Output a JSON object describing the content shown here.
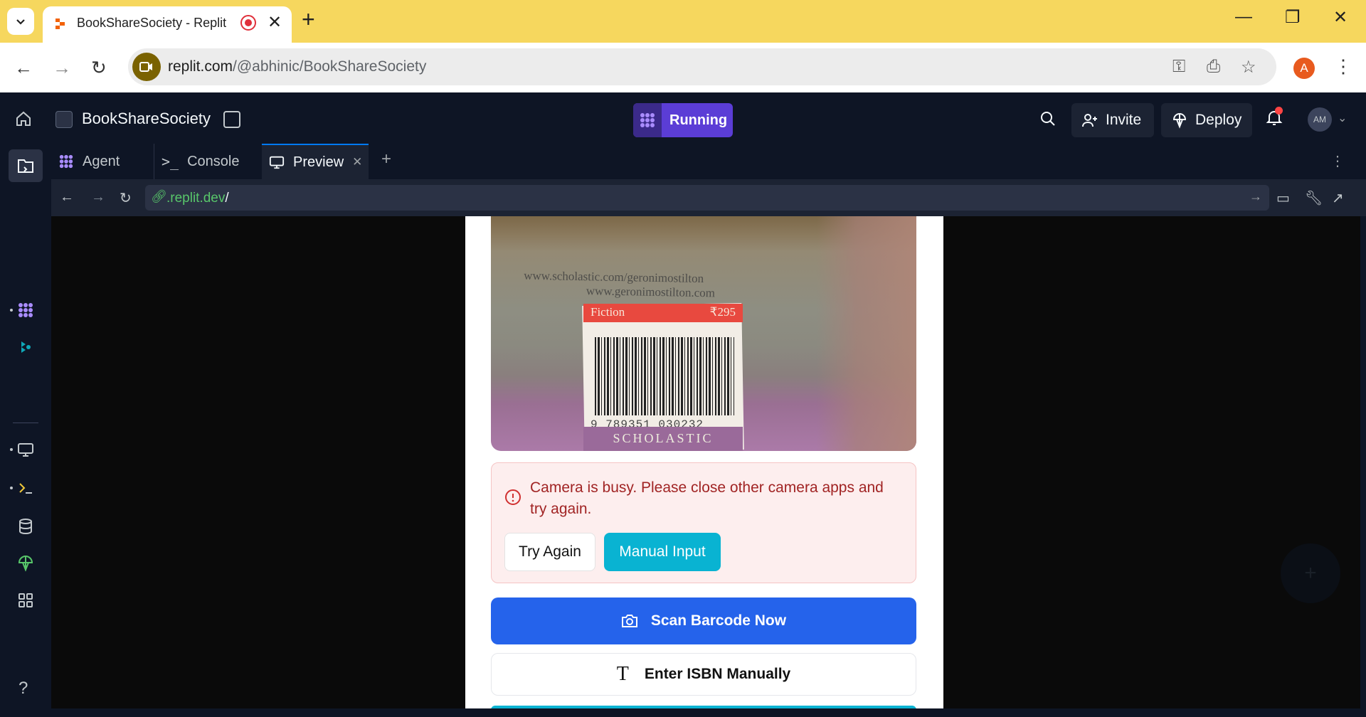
{
  "browser": {
    "tab_title": "BookShareSociety - Replit",
    "url_host": "replit.com",
    "url_path": "/@abhinic/BookShareSociety",
    "profile_initial": "A"
  },
  "app": {
    "repl_name": "BookShareSociety",
    "status_label": "Running",
    "invite_label": "Invite",
    "deploy_label": "Deploy",
    "avatar_initials": "AM",
    "accent_color": "#5b3dd6"
  },
  "pane_tabs": [
    {
      "label": "Agent"
    },
    {
      "label": "Console"
    },
    {
      "label": "Preview"
    }
  ],
  "preview": {
    "url_host": ".replit.dev",
    "url_path": "/"
  },
  "camera": {
    "label_genre": "Fiction",
    "label_price": "₹295",
    "isbn_printed": "9 789351 030232",
    "publisher": "SCHOLASTIC",
    "website_lines": [
      "www.scholastic.com/geronimostilton",
      "www.geronimostilton.com"
    ]
  },
  "alert": {
    "message": "Camera is busy. Please close other camera apps and try again.",
    "try_again_label": "Try Again",
    "manual_input_label": "Manual Input"
  },
  "actions": {
    "scan_label": "Scan Barcode Now",
    "isbn_label": "Enter ISBN Manually"
  },
  "sidebar": {
    "help_label": "?"
  }
}
